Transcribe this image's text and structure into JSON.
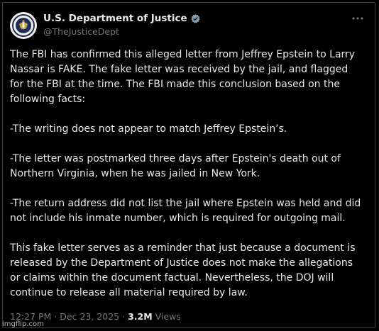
{
  "account": {
    "name": "U.S. Department of Justice",
    "handle": "@TheJusticeDept",
    "verified_icon": "verified-badge-icon",
    "more_icon": "more-horizontal-icon"
  },
  "post": {
    "paragraphs": [
      "The FBI has confirmed this alleged letter from Jeffrey Epstein to Larry Nassar is FAKE. The fake letter was received by the jail, and flagged for the FBI at the time. The FBI made this conclusion based on the following facts:",
      "-The writing does not appear to match Jeffrey Epstein’s.",
      "-The letter was postmarked three days after Epstein's death out of Northern Virginia, when he was jailed in New York.",
      "-The return address did not list the jail where Epstein was held and did not include his inmate number, which is required for outgoing mail.",
      "This fake letter serves as a reminder that just because a document is released by the Department of Justice does not make the allegations or claims within the document factual. Nevertheless, the DOJ will continue to release all material required by law."
    ]
  },
  "meta": {
    "time": "12:27 PM",
    "separator": "·",
    "date": "Dec 23, 2025",
    "views_count": "3.2M",
    "views_label": "Views"
  },
  "watermark": "imgflip.com",
  "colors": {
    "background": "#000000",
    "text": "#e7e9ea",
    "secondary": "#71767b",
    "verified": "#829aab"
  }
}
